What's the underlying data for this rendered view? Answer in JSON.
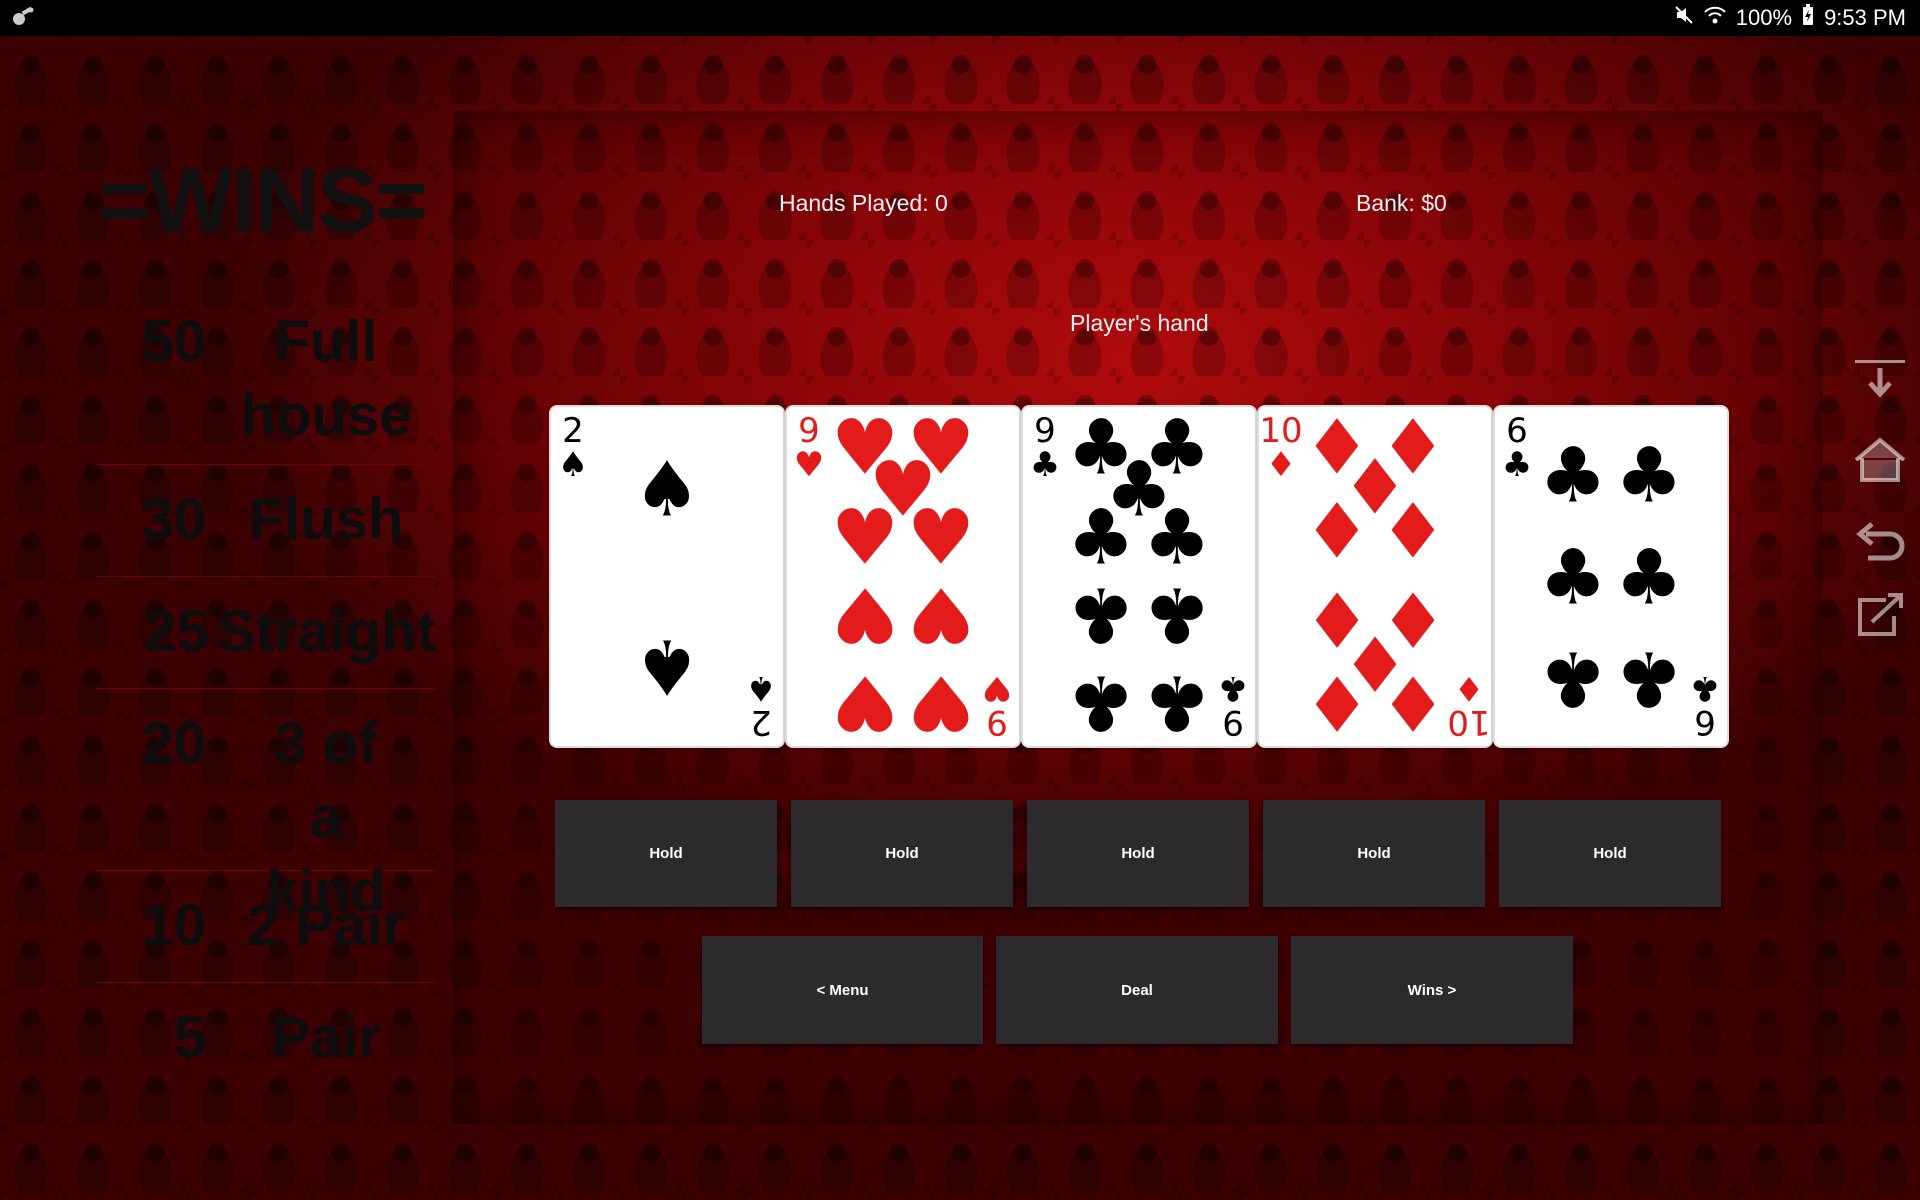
{
  "status_bar": {
    "battery": "100%",
    "time": "9:53 PM",
    "icons": [
      "app-notification-icon",
      "mute-icon",
      "wifi-icon",
      "battery-charging-icon"
    ]
  },
  "wins": {
    "title": "=WINS=",
    "rows": [
      {
        "amount": "50",
        "hand": "Full house"
      },
      {
        "amount": "30",
        "hand": "Flush"
      },
      {
        "amount": "25",
        "hand": "Straight"
      },
      {
        "amount": "20",
        "hand": "3 of a kind"
      },
      {
        "amount": "10",
        "hand": "2 Pair"
      },
      {
        "amount": "5",
        "hand": "Pair"
      }
    ]
  },
  "game": {
    "hands_played": "Hands Played: 0",
    "bank": "Bank: $0",
    "players_hand_label": "Player's hand",
    "cards": [
      {
        "rank": "2",
        "suit": "spades",
        "color": "#000000"
      },
      {
        "rank": "9",
        "suit": "hearts",
        "color": "#e31b1b"
      },
      {
        "rank": "9",
        "suit": "clubs",
        "color": "#000000"
      },
      {
        "rank": "10",
        "suit": "diamonds",
        "color": "#e31b1b"
      },
      {
        "rank": "6",
        "suit": "clubs",
        "color": "#000000"
      }
    ],
    "hold_label": "Hold",
    "menu_label": "< Menu",
    "deal_label": "Deal",
    "wins_label": "Wins >"
  },
  "side_toolbar": [
    "download-icon",
    "home-icon",
    "undo-icon",
    "share-icon"
  ],
  "colors": {
    "background_red": "#b00b0d",
    "button_bg": "#2c2a2d",
    "card_red": "#e31b1b"
  }
}
